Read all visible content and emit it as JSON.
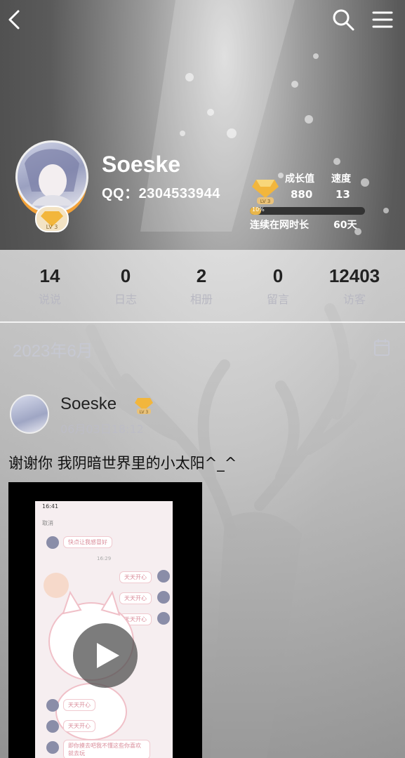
{
  "header": {
    "back_icon": "back-arrow-icon",
    "search_icon": "search-icon",
    "menu_icon": "menu-icon"
  },
  "profile": {
    "name": "Soeske",
    "qq": "QQ：2304533944",
    "level_badge": "LV 3",
    "growth_label": "成长值",
    "growth_value": "880",
    "speed_label": "速度",
    "speed_value": "13",
    "progress_percent": 10,
    "progress_text": "10%",
    "online_label": "连续在网时长",
    "online_value": "60天"
  },
  "counts": [
    {
      "value": "14",
      "label": "说说"
    },
    {
      "value": "0",
      "label": "日志"
    },
    {
      "value": "2",
      "label": "相册"
    },
    {
      "value": "0",
      "label": "留言"
    },
    {
      "value": "12403",
      "label": "访客"
    }
  ],
  "feed": {
    "month": "2023年6月",
    "post": {
      "author": "Soeske",
      "level_badge": "LV 3",
      "time": "06月03日18:12",
      "text": "谢谢你 我阴暗世界里的小太阳^_^"
    }
  },
  "video_preview": {
    "status_time": "16:41",
    "cancel": "取消",
    "stamp": "16:29",
    "messages_in": [
      "快点让我感冒好"
    ],
    "messages_out": [
      "天天开心",
      "天天开心",
      "天天开心"
    ],
    "messages_in_bottom": [
      "天天开心",
      "天天开心",
      "即你摸去吧我不懂这些你喜欢就去玩"
    ]
  },
  "colors": {
    "accent_orange": "#f2a23a",
    "progress_fill": "#e8b64a",
    "label_gray": "#b8b8c2"
  }
}
